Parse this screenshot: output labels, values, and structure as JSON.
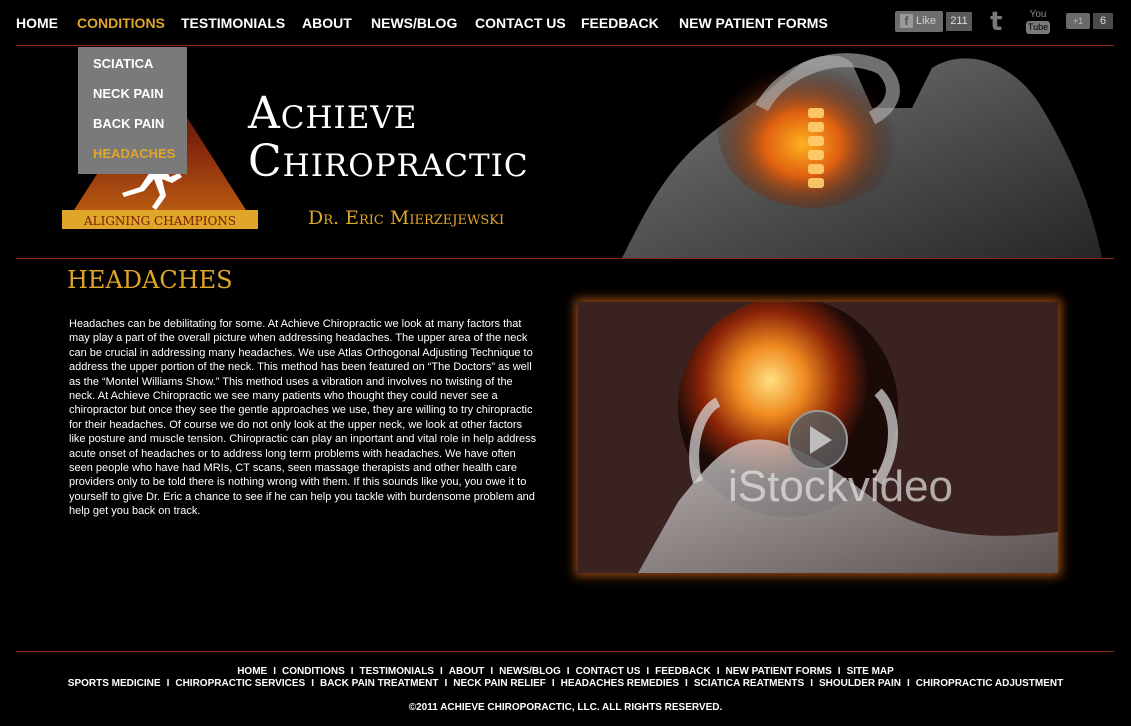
{
  "nav": {
    "items": [
      "HOME",
      "CONDITIONS",
      "TESTIMONIALS",
      "ABOUT",
      "NEWS/BLOG",
      "CONTACT US",
      "FEEDBACK",
      "NEW PATIENT FORMS"
    ],
    "active": "CONDITIONS"
  },
  "social": {
    "facebook_label": "Like",
    "facebook_count": "211",
    "youtube_top": "You",
    "youtube_bottom": "Tube",
    "gplus_label": "+1",
    "gplus_count": "6"
  },
  "dropdown": {
    "items": [
      "SCIATICA",
      "NECK PAIN",
      "BACK PAIN",
      "HEADACHES"
    ],
    "active": "HEADACHES"
  },
  "brand": {
    "line1": "Achieve",
    "line2": "Chiropractic",
    "doctor": "Dr. Eric Mierzejewski",
    "logo_tagline": "ALIGNING CHAMPIONS"
  },
  "page": {
    "title": "HEADACHES",
    "body": "Headaches can be debilitating for some. At Achieve Chiropractic we look at many factors that may play a part of the overall picture when addressing headaches. The upper area of the neck can be crucial in addressing many headaches. We use Atlas Orthogonal Adjusting Technique to address the upper portion of the neck. This method has been featured on “The Doctors” as well as the “Montel Williams Show.” This method uses a vibration and involves no twisting of the neck. At Achieve Chiropractic we see many patients who thought they could never see a chiropractor but once they see the gentle approaches we use, they are willing to try chiropractic for their headaches. Of course we do not only look at the upper neck, we look at other factors like posture and  muscle tension. Chiropractic can play an inportant and vital role in help address acute onset of headaches or to address long term problems with headaches. We have often seen people who have had MRIs, CT scans, seen massage therapists and other health care providers only to be told there is nothing wrong with them. If this sounds like you, you owe it to yourself to give Dr. Eric a chance to see if he can help you tackle with burdensome problem and help get you back on track."
  },
  "video": {
    "watermark": "iStockvideo"
  },
  "footer": {
    "row1": [
      "HOME",
      "CONDITIONS",
      "TESTIMONIALS",
      "ABOUT",
      "NEWS/BLOG",
      "CONTACT US",
      "FEEDBACK",
      "NEW PATIENT FORMS",
      "SITE MAP"
    ],
    "row2": [
      "SPORTS MEDICINE",
      "CHIROPRACTIC SERVICES",
      "BACK PAIN TREATMENT",
      "NECK PAIN RELIEF",
      "HEADACHES REMEDIES",
      "SCIATICA REATMENTS",
      "SHOULDER PAIN",
      "CHIROPRACTIC ADJUSTMENT"
    ],
    "separator": "I",
    "copyright": "©2011 ACHIEVE CHIROPORACTIC, LLC. ALL RIGHTS RESERVED."
  },
  "colors": {
    "accent": "#e0a62a",
    "rule": "#8a2a10",
    "dropdown_bg": "#7a7a7a"
  }
}
